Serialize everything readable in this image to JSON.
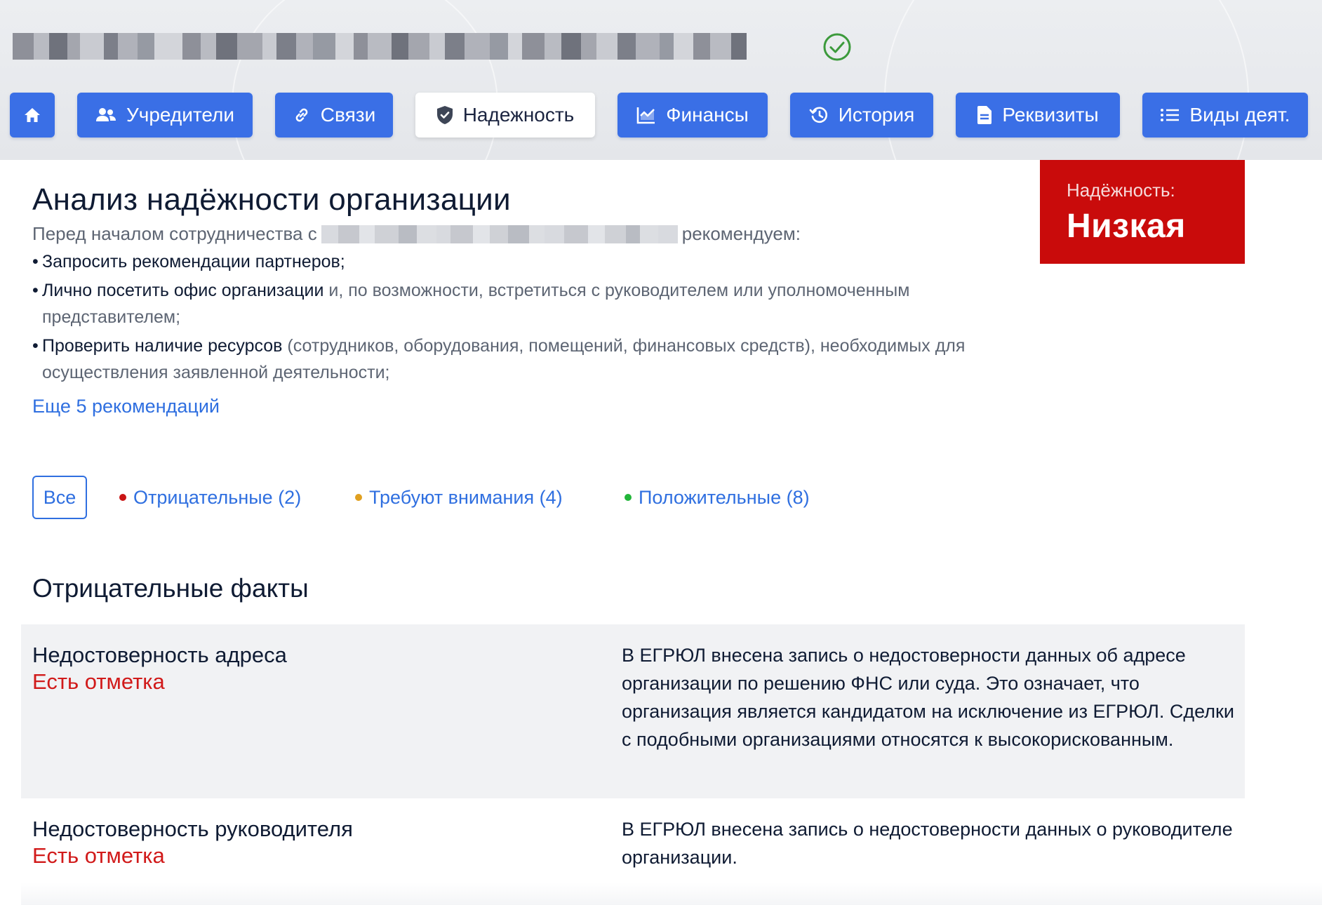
{
  "header": {
    "verified_icon": "check-circle-icon",
    "verified_color": "#3c9a3c"
  },
  "nav": {
    "home_icon": "home-icon",
    "tabs": [
      {
        "label": "Учредители",
        "icon": "people-icon"
      },
      {
        "label": "Связи",
        "icon": "link-icon"
      },
      {
        "label": "Надежность",
        "icon": "shield-icon",
        "active": true
      },
      {
        "label": "Финансы",
        "icon": "chart-icon"
      },
      {
        "label": "История",
        "icon": "history-icon"
      },
      {
        "label": "Реквизиты",
        "icon": "document-icon"
      },
      {
        "label": "Виды деят.",
        "icon": "list-icon"
      }
    ]
  },
  "analysis": {
    "title": "Анализ надёжности организации",
    "intro_before": "Перед началом сотрудничества с",
    "intro_after": "рекомендуем:",
    "recommendations": [
      {
        "strong": "Запросить рекомендации партнеров;",
        "rest": ""
      },
      {
        "strong": "Лично посетить офис организации",
        "rest": " и, по возможности, встретиться с руководителем или уполномоченным представителем;"
      },
      {
        "strong": "Проверить наличие ресурсов",
        "rest": " (сотрудников, оборудования, помещений, финансовых средств), необходимых для осуществления заявленной деятельности;"
      }
    ],
    "more_link": "Еще 5 рекомендаций"
  },
  "reliability_badge": {
    "label": "Надёжность:",
    "value": "Низкая",
    "color": "#c90b0b"
  },
  "filters": {
    "all": "Все",
    "negative": "Отрицательные (2)",
    "attention": "Требуют внимания (4)",
    "positive": "Положительные (8)",
    "colors": {
      "negative": "#c91515",
      "attention": "#e0a020",
      "positive": "#22b53a"
    }
  },
  "negative_facts": {
    "title": "Отрицательные факты",
    "items": [
      {
        "name": "Недостоверность адреса",
        "status": "Есть отметка",
        "description": "В ЕГРЮЛ внесена запись о недостоверности данных об адресе организации по решению ФНС или суда. Это означает, что организация является кандидатом на исключение из ЕГРЮЛ. Сделки с подобными организациями относятся к высокорискованным."
      },
      {
        "name": "Недостоверность руководителя",
        "status": "Есть отметка",
        "description": "В ЕГРЮЛ внесена запись о недостоверности данных о руководителе организации."
      }
    ]
  }
}
